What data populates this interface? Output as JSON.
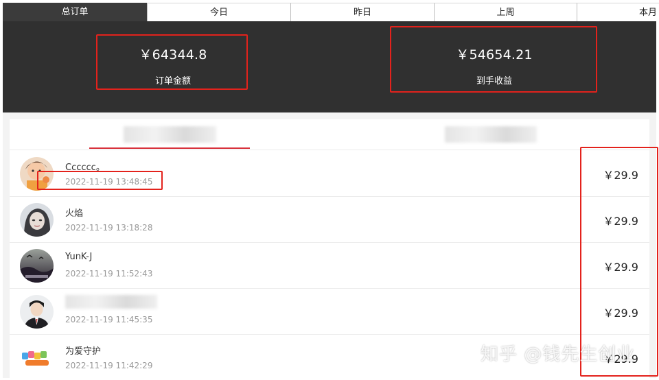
{
  "tabs": [
    {
      "label": "总订单",
      "active": true
    },
    {
      "label": "今日",
      "active": false
    },
    {
      "label": "昨日",
      "active": false
    },
    {
      "label": "上周",
      "active": false
    },
    {
      "label": "本月",
      "active": false
    }
  ],
  "stats": {
    "order_amount": {
      "value": "￥64344.8",
      "label": "订单金额"
    },
    "net_earnings": {
      "value": "￥54654.21",
      "label": "到手收益"
    }
  },
  "orders": [
    {
      "name": "Cccccc。",
      "time": "2022-11-19 13:48:45",
      "price": "￥29.9",
      "avatar": "avatar-photo-1"
    },
    {
      "name": "火焰",
      "time": "2022-11-19 13:18:28",
      "price": "￥29.9",
      "avatar": "avatar-photo-2"
    },
    {
      "name": "YunK-J",
      "time": "2022-11-19 11:52:43",
      "price": "￥29.9",
      "avatar": "avatar-photo-3"
    },
    {
      "name": "",
      "time": "2022-11-19 11:45:35",
      "price": "￥29.9",
      "avatar": "avatar-photo-4"
    },
    {
      "name": "为爱守护",
      "time": "2022-11-19 11:42:29",
      "price": "￥29.9",
      "avatar": "avatar-photo-5"
    }
  ],
  "watermark": "知乎 @钱先生创业",
  "colors": {
    "highlight": "#e3221c",
    "panel": "#303030",
    "underline": "#d8323c"
  }
}
